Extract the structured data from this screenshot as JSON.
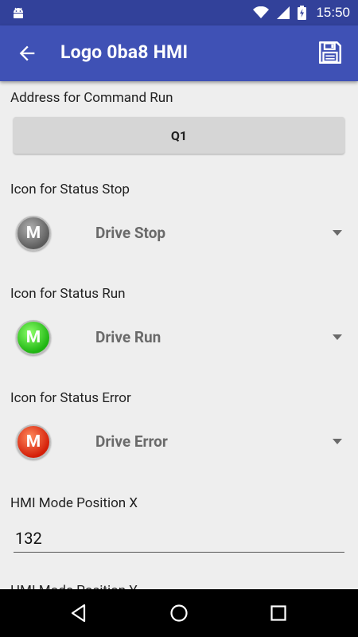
{
  "status_bar": {
    "time": "15:50",
    "icons": [
      "android-debug-icon",
      "wifi-icon",
      "signal-icon",
      "battery-charging-icon"
    ]
  },
  "app_bar": {
    "title": "Logo 0ba8 HMI",
    "back_icon": "arrow-left-icon",
    "save_icon": "floppy-disk-icon"
  },
  "form": {
    "command_run": {
      "label": "Address for Command Run",
      "value": "Q1"
    },
    "status_stop": {
      "label": "Icon for Status Stop",
      "icon_letter": "M",
      "icon_color": "#757575",
      "selected": "Drive Stop"
    },
    "status_run": {
      "label": "Icon for Status Run",
      "icon_letter": "M",
      "icon_color": "#2ecc1a",
      "selected": "Drive Run"
    },
    "status_error": {
      "label": "Icon for Status Error",
      "icon_letter": "M",
      "icon_color": "#e53010",
      "selected": "Drive Error"
    },
    "hmi_position_x": {
      "label": "HMI Mode Position X",
      "value": "132"
    },
    "next_label_partial": "HMI Mode Position Y"
  },
  "nav_bar": {
    "back": "nav-back-icon",
    "home": "nav-home-icon",
    "recents": "nav-recents-icon"
  },
  "colors": {
    "primary": "#3f51b5",
    "primary_dark": "#32419a",
    "background": "#eeeeee"
  }
}
